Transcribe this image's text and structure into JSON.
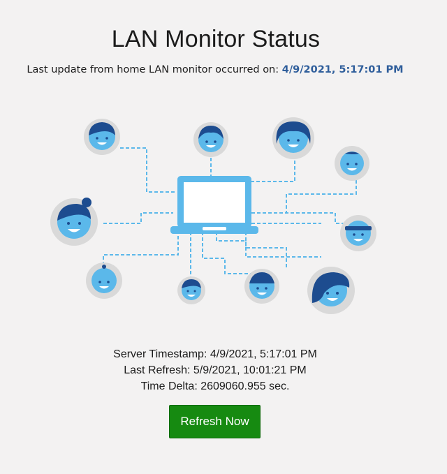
{
  "page": {
    "title": "LAN Monitor Status",
    "update_prefix": "Last update from home LAN monitor occurred on:",
    "update_timestamp": "4/9/2021, 5:17:01 PM"
  },
  "status": {
    "server_timestamp": "Server Timestamp: 4/9/2021, 5:17:01 PM",
    "last_refresh": "Last Refresh: 5/9/2021, 10:01:21 PM",
    "time_delta": "Time Delta: 2609060.955 sec."
  },
  "actions": {
    "refresh_label": "Refresh Now"
  },
  "illustration": {
    "icon": "network-laptop-people-icon"
  },
  "colors": {
    "accent": "#2f5e9b",
    "button": "#168a11",
    "line": "#5bb8ea",
    "face": "#5bb8ea",
    "avatar_ring": "#d9d9d9",
    "hair": "#1d4c8f"
  }
}
